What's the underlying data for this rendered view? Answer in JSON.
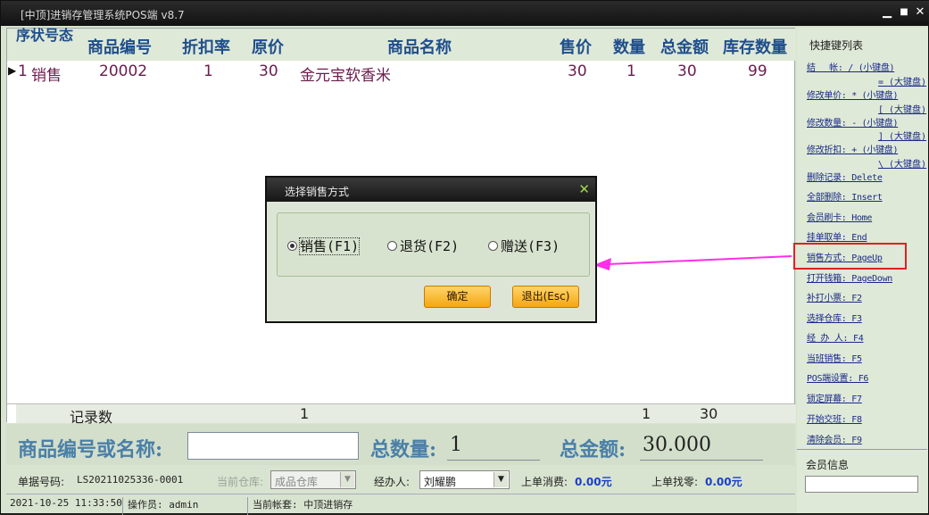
{
  "window": {
    "title": "[中顶]进销存管理系统POS端 v8.7",
    "minimize": "▁",
    "maximize": "■",
    "close": "✕"
  },
  "grid": {
    "headers": {
      "seq_status": "序状号态",
      "code": "商品编号",
      "discount": "折扣率",
      "orig_price": "原价",
      "name": "商品名称",
      "price": "售价",
      "qty": "数量",
      "total": "总金额",
      "stock": "库存数量"
    },
    "rows": [
      {
        "seq": "1",
        "status": "销售",
        "code": "20002",
        "discount": "1",
        "orig_price": "30",
        "name": "金元宝软香米",
        "price": "30",
        "qty": "1",
        "total": "30",
        "stock": "99"
      }
    ],
    "footer": {
      "label": "记录数",
      "count": "1",
      "qty_sum": "1",
      "total_sum": "30"
    }
  },
  "midbar": {
    "code_label": "商品编号或名称:",
    "code_value": "",
    "total_qty_label": "总数量:",
    "total_qty": "1",
    "total_amount_label": "总金额:",
    "total_amount": "30.000"
  },
  "infobar": {
    "order_no_label": "单据号码:",
    "order_no": "LS20211025336-0001",
    "warehouse_label": "当前仓库:",
    "warehouse": "成品仓库",
    "agent_label": "经办人:",
    "agent": "刘耀鹏",
    "last_spend_label": "上单消费:",
    "last_spend": "0.00元",
    "last_change_label": "上单找零:",
    "last_change": "0.00元"
  },
  "statusbar": {
    "datetime": "2021-10-25 11:33:50",
    "operator": "操作员: admin",
    "account": "当前帐套: 中顶进销存"
  },
  "shortcuts": {
    "title": "快捷键列表",
    "items": [
      {
        "a": "结　 帐: / (小键盘)",
        "b": "= (大键盘)"
      },
      {
        "a": "修改单价: * (小键盘)",
        "b": "[ (大键盘)"
      },
      {
        "a": "修改数量: - (小键盘)",
        "b": "] (大键盘)"
      },
      {
        "a": "修改折扣: + (小键盘)",
        "b": "\\ (大键盘)"
      },
      {
        "a": "删除记录: Delete"
      },
      {
        "a": "全部删除: Insert"
      },
      {
        "a": "会员刷卡: Home"
      },
      {
        "a": "挂单取单: End"
      },
      {
        "a": "销售方式: PageUp"
      },
      {
        "a": "打开钱箱: PageDown"
      },
      {
        "a": "补打小票: F2"
      },
      {
        "a": "选择仓库: F3"
      },
      {
        "a": "经 办 人: F4"
      },
      {
        "a": "当班销售: F5"
      },
      {
        "a": "POS端设置: F6"
      },
      {
        "a": "锁定屏幕: F7"
      },
      {
        "a": "开始交班: F8"
      },
      {
        "a": "清除会员: F9"
      }
    ],
    "member_label": "会员信息"
  },
  "dialog": {
    "title": "选择销售方式",
    "close": "✕",
    "options": [
      {
        "label": "销售(F1)",
        "checked": true
      },
      {
        "label": "退货(F2)",
        "checked": false
      },
      {
        "label": "赠送(F3)",
        "checked": false
      }
    ],
    "ok": "确定",
    "cancel": "退出(Esc)"
  },
  "colors": {
    "accent_arrow": "#ff2ee8",
    "highlight_box": "#e02020",
    "value_blue": "#1a40c8"
  }
}
